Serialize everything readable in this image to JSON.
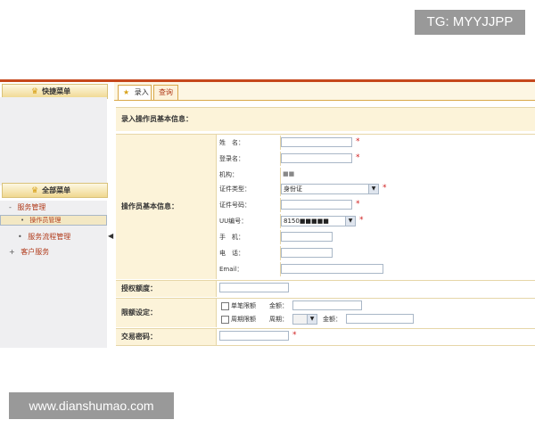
{
  "watermarks": {
    "top": "TG: MYYJJPP",
    "bottom": "www.dianshumao.com"
  },
  "sidebar": {
    "quick_menu_title": "快捷菜单",
    "all_menu_title": "全部菜单",
    "items": [
      {
        "label": "服务管理",
        "prefix": "-"
      },
      {
        "label": "操作员管理",
        "prefix": "•"
      },
      {
        "label": "服务流程管理",
        "prefix": "•"
      },
      {
        "label": "客户服务",
        "prefix": "+"
      }
    ],
    "collapse_glyph": "◀"
  },
  "tabs": [
    {
      "label": "录入"
    },
    {
      "label": "查询"
    }
  ],
  "form": {
    "section_title": "录入操作员基本信息：",
    "basic_group_label": "操作员基本信息：",
    "fields": {
      "name_label": "姓　名：",
      "login_label": "登录名：",
      "org_label": "机构：",
      "org_value": "■■ ■■",
      "id_type_label": "证件类型：",
      "id_type_value": "身份证",
      "id_number_label": "证件号码：",
      "uu_label": "UU编号：",
      "uu_value": "8150■■■■■",
      "mobile_label": "手　机：",
      "phone_label": "电　话：",
      "email_label": "Email："
    },
    "credit_label": "授权额度：",
    "limit_label": "限额设定：",
    "single_limit_label": "单笔限额",
    "amount_label": "金额：",
    "period_limit_label": "周期限额",
    "period_label": "周期：",
    "amount2_label": "金额：",
    "password_label": "交易密码：",
    "required_mark": "*"
  },
  "colors": {
    "accent": "#c6471c",
    "label_bg": "#fcf3d9",
    "border": "#e6d6a8",
    "required": "#d02020"
  }
}
